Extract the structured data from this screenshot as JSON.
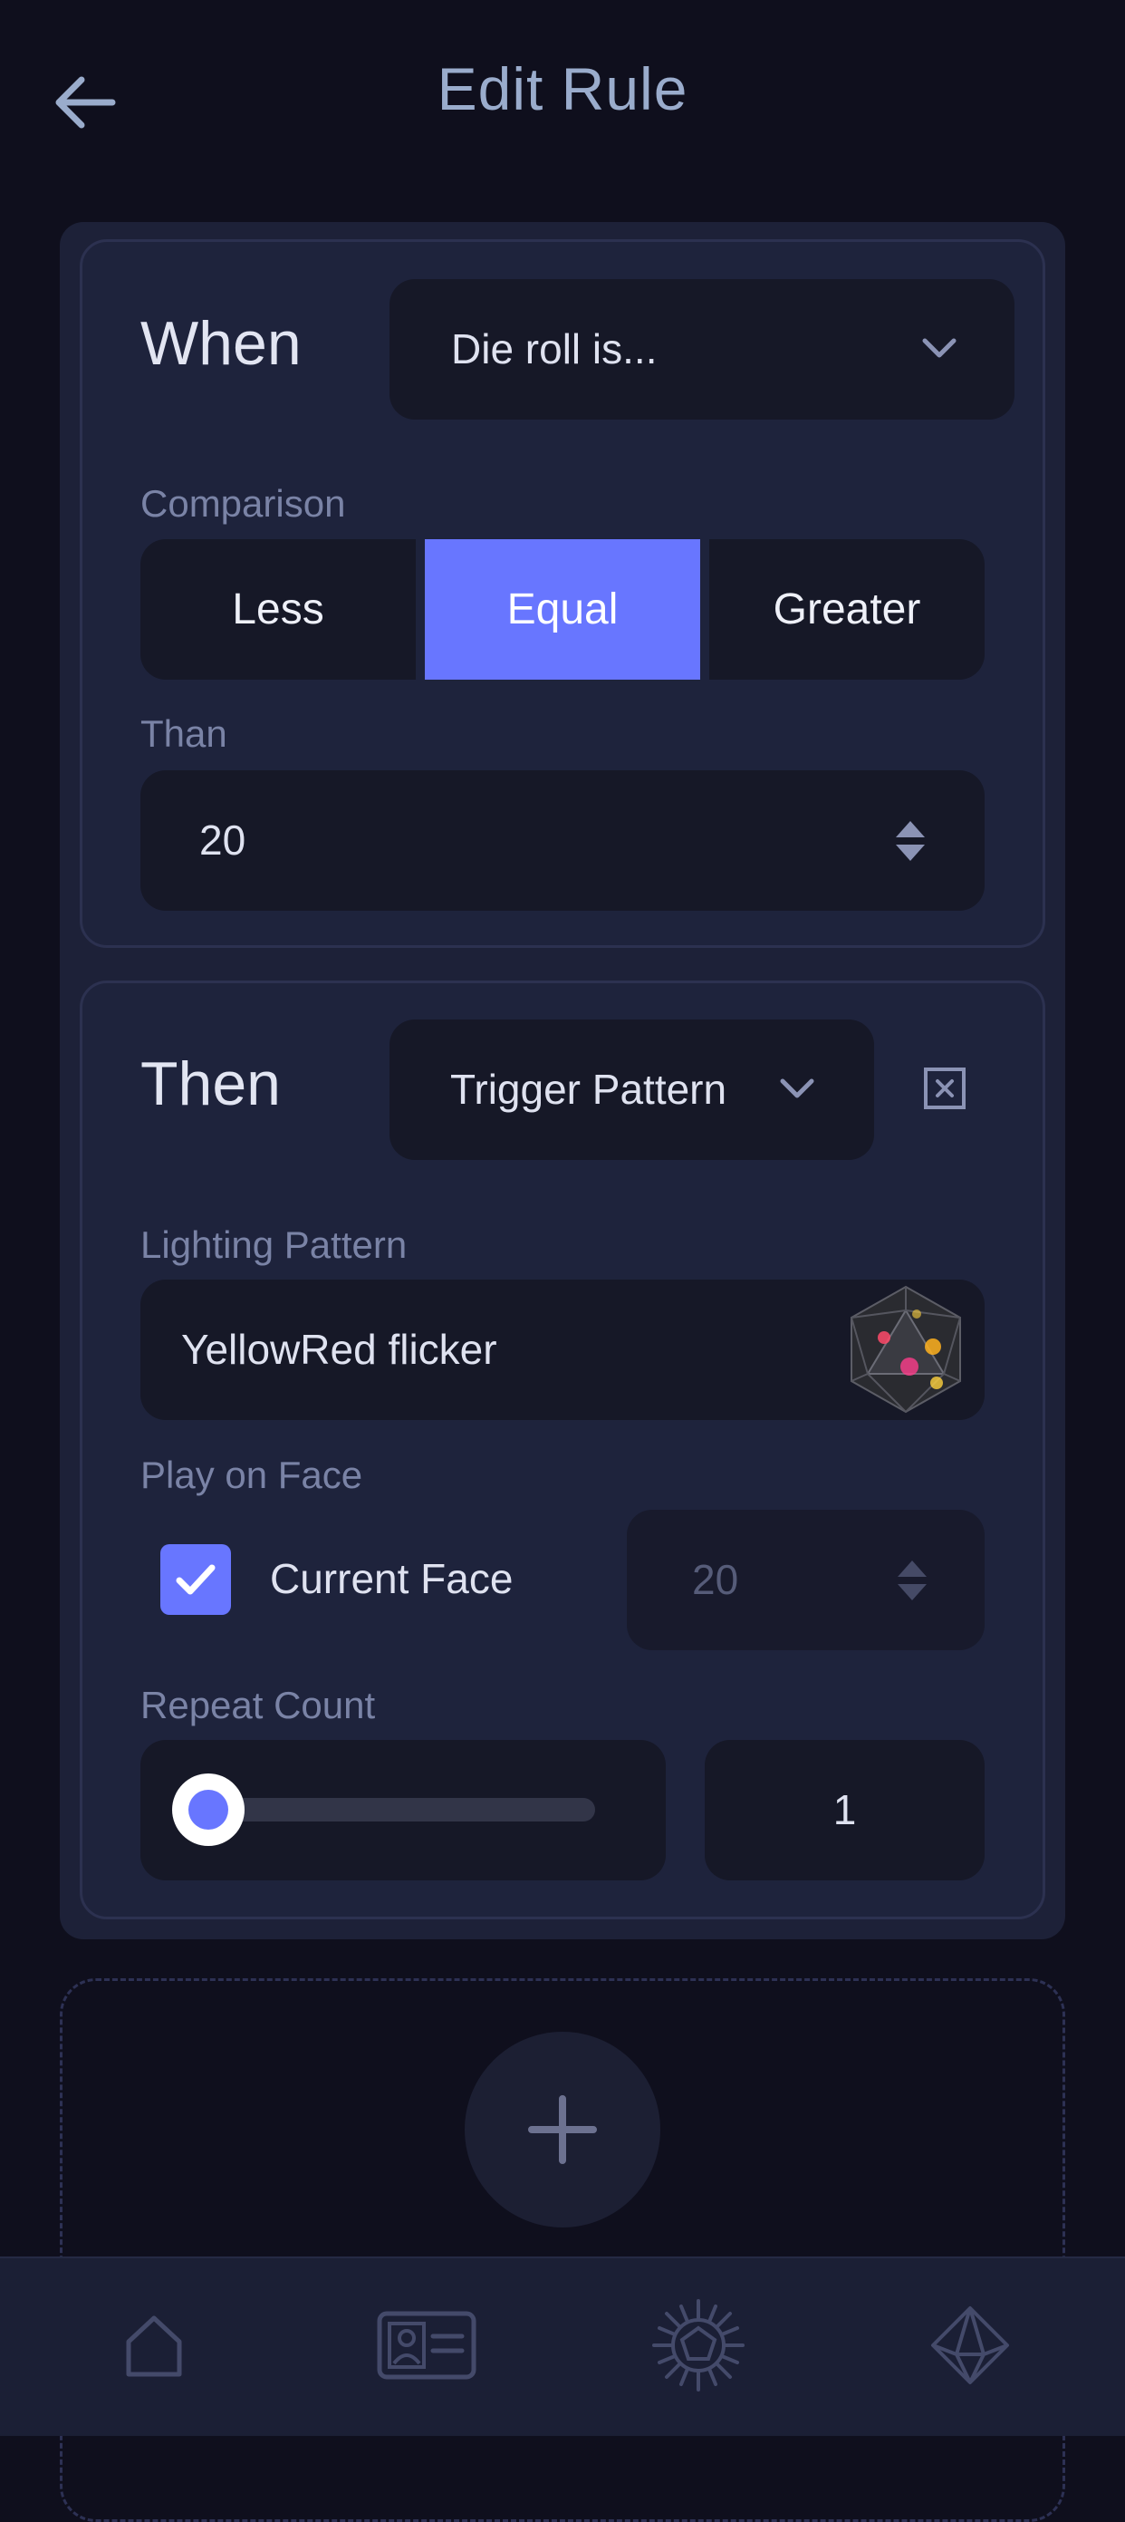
{
  "header": {
    "title": "Edit Rule",
    "back_icon": "arrow-left-icon"
  },
  "when": {
    "title": "When",
    "condition_select": "Die roll is...",
    "comparison_label": "Comparison",
    "comparison_options": [
      "Less",
      "Equal",
      "Greater"
    ],
    "comparison_selected": "Equal",
    "than_label": "Than",
    "than_value": "20"
  },
  "then": {
    "title": "Then",
    "action_select": "Trigger Pattern",
    "lighting_label": "Lighting Pattern",
    "lighting_value": "YellowRed flicker",
    "play_on_face_label": "Play on Face",
    "current_face_label": "Current Face",
    "current_face_checked": true,
    "face_value": "20",
    "repeat_label": "Repeat Count",
    "repeat_value": "1",
    "repeat_slider_fraction": 0.0
  },
  "bottom_nav": {
    "items": [
      "home-icon",
      "profile-card-icon",
      "dice-sun-icon",
      "d20-die-icon"
    ]
  },
  "colors": {
    "accent": "#6876ff",
    "background": "#0f0f1d",
    "panel": "#1d2138",
    "field": "#161827"
  }
}
